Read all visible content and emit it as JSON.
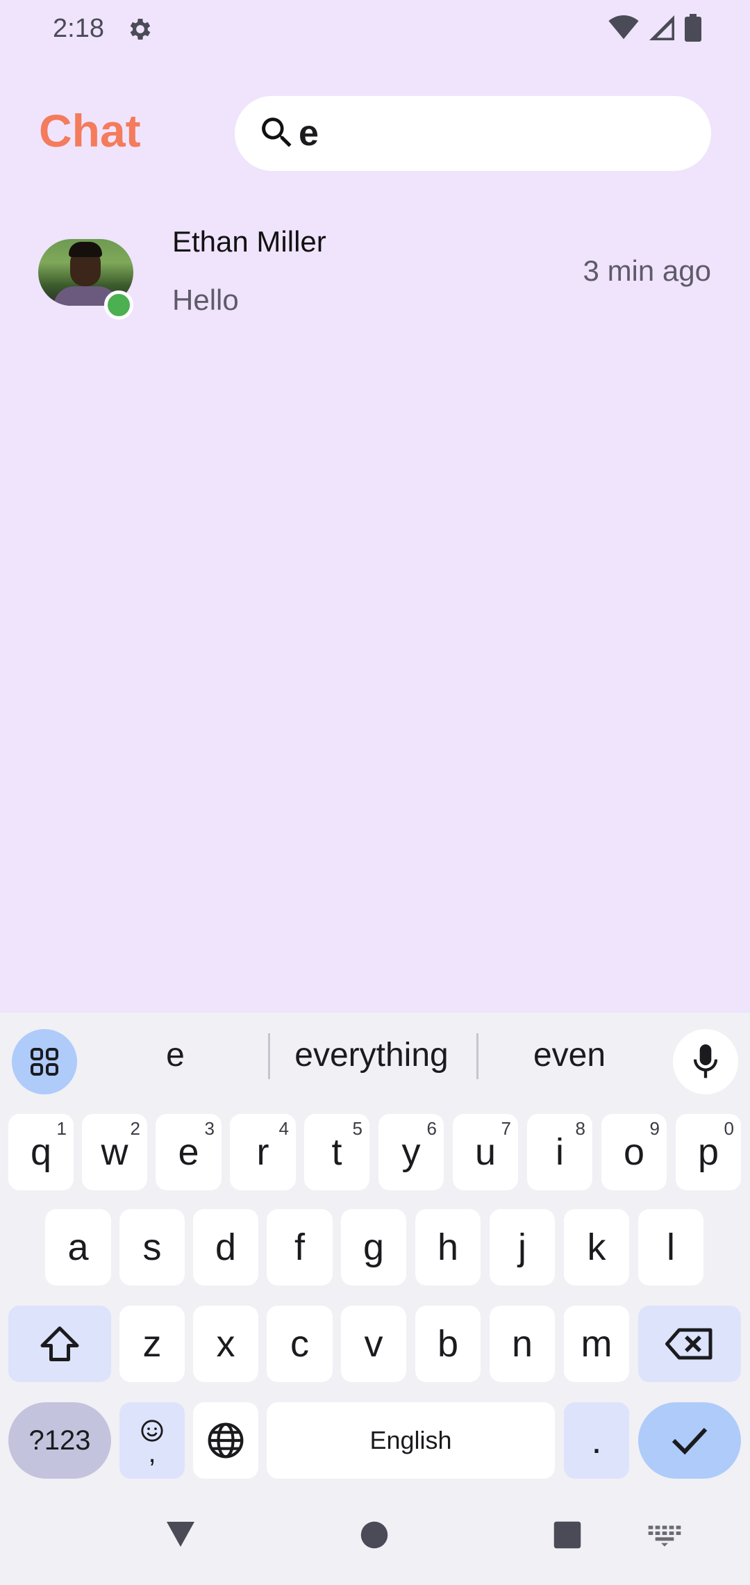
{
  "status_bar": {
    "time": "2:18"
  },
  "header": {
    "title": "Chat",
    "search_value": "e"
  },
  "chats": [
    {
      "name": "Ethan Miller",
      "message": "Hello",
      "time": "3 min ago",
      "online": true
    }
  ],
  "keyboard": {
    "suggestions": [
      "e",
      "everything",
      "even"
    ],
    "row1": [
      {
        "key": "q",
        "hint": "1"
      },
      {
        "key": "w",
        "hint": "2"
      },
      {
        "key": "e",
        "hint": "3"
      },
      {
        "key": "r",
        "hint": "4"
      },
      {
        "key": "t",
        "hint": "5"
      },
      {
        "key": "y",
        "hint": "6"
      },
      {
        "key": "u",
        "hint": "7"
      },
      {
        "key": "i",
        "hint": "8"
      },
      {
        "key": "o",
        "hint": "9"
      },
      {
        "key": "p",
        "hint": "0"
      }
    ],
    "row2": [
      "a",
      "s",
      "d",
      "f",
      "g",
      "h",
      "j",
      "k",
      "l"
    ],
    "row3": [
      "z",
      "x",
      "c",
      "v",
      "b",
      "n",
      "m"
    ],
    "symbols_label": "?123",
    "emoji_comma": ",",
    "space_label": "English",
    "period": "."
  },
  "colors": {
    "background": "#EFE4FC",
    "accent": "#F47B5C",
    "online": "#4CAF50",
    "keyboard_bg": "#F0F0F5",
    "enter_key": "#AECBFA"
  }
}
